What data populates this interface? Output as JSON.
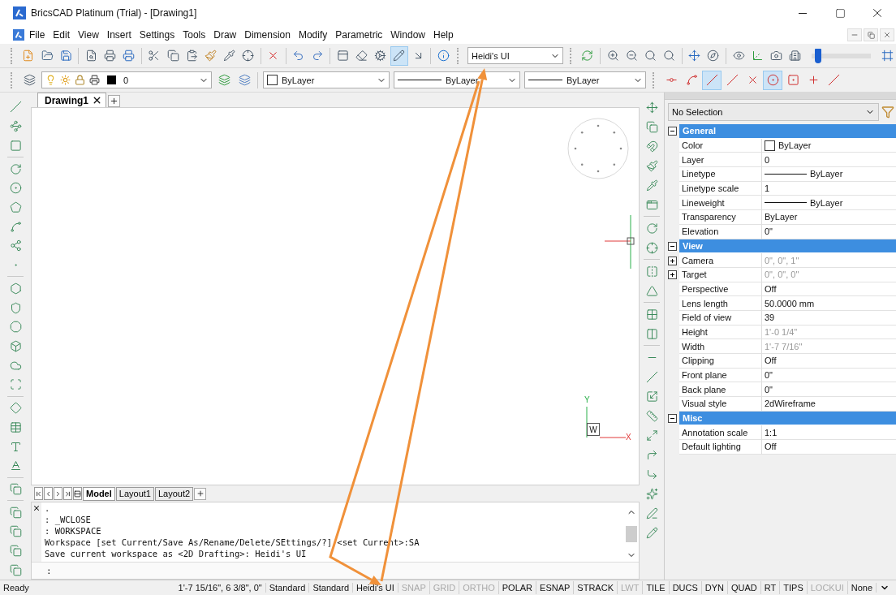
{
  "window": {
    "title": "BricsCAD Platinum (Trial) - [Drawing1]"
  },
  "menus": [
    "File",
    "Edit",
    "View",
    "Insert",
    "Settings",
    "Tools",
    "Draw",
    "Dimension",
    "Modify",
    "Parametric",
    "Window",
    "Help"
  ],
  "standard_toolbar": {
    "buttons": [
      {
        "selected": false
      },
      {
        "selected": false
      },
      {
        "selected": false
      },
      {
        "selected": false
      },
      {
        "selected": false
      },
      {
        "selected": false
      },
      {
        "selected": false
      },
      {
        "selected": false
      },
      {
        "selected": false
      },
      {
        "selected": false
      },
      {
        "selected": false
      },
      {
        "selected": false
      },
      {
        "selected": false
      },
      {
        "selected": false
      },
      {
        "selected": false
      },
      {
        "selected": false
      },
      {
        "selected": false
      },
      {
        "selected": false
      },
      {
        "selected": true
      },
      {
        "selected": false
      },
      {
        "selected": false
      }
    ],
    "workspace": "Heidi's UI",
    "slider": {
      "level": 0.06
    }
  },
  "layer_toolbar": {
    "layer": "0",
    "color_setting": "ByLayer",
    "linetype": "ByLayer",
    "lineweight": "ByLayer",
    "snap_buttons": [
      {
        "selected": false
      },
      {
        "selected": false
      },
      {
        "selected": true
      },
      {
        "selected": false
      },
      {
        "selected": false
      },
      {
        "selected": true
      },
      {
        "selected": false
      },
      {
        "selected": false
      },
      {
        "selected": false
      }
    ]
  },
  "doc_tabs": [
    {
      "label": "Drawing1",
      "selected": true
    }
  ],
  "canvas": {
    "ucs": {
      "y": "Y",
      "w": "W",
      "x": "X"
    }
  },
  "layout_tabs": [
    {
      "label": "Model",
      "selected": true
    },
    {
      "label": "Layout1",
      "selected": false
    },
    {
      "label": "Layout2",
      "selected": false
    }
  ],
  "command_line": {
    "history": [
      ".",
      ": _WCLOSE",
      ": WORKSPACE",
      "Workspace [set Current/Save As/Rename/Delete/SEttings/?] <set Current>:SA",
      "Save current workspace as <2D Drafting>: Heidi's UI"
    ],
    "prompt": ":"
  },
  "properties": {
    "selection": "No Selection",
    "groups": [
      {
        "title": "General",
        "expanded": true,
        "rows": [
          {
            "label": "Color",
            "value": "ByLayer",
            "kind": "swatch",
            "dimmed": false
          },
          {
            "label": "Layer",
            "value": "0",
            "kind": "text",
            "dimmed": false
          },
          {
            "label": "Linetype",
            "value": "ByLayer",
            "kind": "line",
            "dimmed": false
          },
          {
            "label": "Linetype scale",
            "value": "1",
            "kind": "text",
            "dimmed": false
          },
          {
            "label": "Lineweight",
            "value": "ByLayer",
            "kind": "line",
            "dimmed": false
          },
          {
            "label": "Transparency",
            "value": "ByLayer",
            "kind": "text",
            "dimmed": false
          },
          {
            "label": "Elevation",
            "value": "0\"",
            "kind": "text",
            "dimmed": false
          }
        ]
      },
      {
        "title": "View",
        "expanded": true,
        "rows": [
          {
            "label": "Camera",
            "value": "0\", 0\", 1\"",
            "kind": "text",
            "dimmed": true,
            "expanded": false
          },
          {
            "label": "Target",
            "value": "0\", 0\", 0\"",
            "kind": "text",
            "dimmed": true,
            "expanded": false
          },
          {
            "label": "Perspective",
            "value": "Off",
            "kind": "text",
            "dimmed": false
          },
          {
            "label": "Lens length",
            "value": "50.0000 mm",
            "kind": "text",
            "dimmed": false
          },
          {
            "label": "Field of view",
            "value": "39",
            "kind": "text",
            "dimmed": false
          },
          {
            "label": "Height",
            "value": "1'-0 1/4\"",
            "kind": "text",
            "dimmed": true
          },
          {
            "label": "Width",
            "value": "1'-7 7/16\"",
            "kind": "text",
            "dimmed": true
          },
          {
            "label": "Clipping",
            "value": "Off",
            "kind": "text",
            "dimmed": false
          },
          {
            "label": "Front plane",
            "value": "0\"",
            "kind": "text",
            "dimmed": false
          },
          {
            "label": "Back plane",
            "value": "0\"",
            "kind": "text",
            "dimmed": false
          },
          {
            "label": "Visual style",
            "value": "2dWireframe",
            "kind": "text",
            "dimmed": false
          }
        ]
      },
      {
        "title": "Misc",
        "expanded": true,
        "rows": [
          {
            "label": "Annotation scale",
            "value": "1:1",
            "kind": "text",
            "dimmed": false
          },
          {
            "label": "Default lighting",
            "value": "Off",
            "kind": "text",
            "dimmed": false
          }
        ]
      }
    ]
  },
  "status_bar": {
    "state": "Ready",
    "coords": "1'-7 15/16\", 6 3/8\", 0\"",
    "texts": [
      "Standard",
      "Standard",
      "Heidi's UI"
    ],
    "toggles": [
      {
        "label": "SNAP",
        "on": false
      },
      {
        "label": "GRID",
        "on": false
      },
      {
        "label": "ORTHO",
        "on": false
      },
      {
        "label": "POLAR",
        "on": true
      },
      {
        "label": "ESNAP",
        "on": true
      },
      {
        "label": "STRACK",
        "on": true
      },
      {
        "label": "LWT",
        "on": false
      },
      {
        "label": "TILE",
        "on": true
      },
      {
        "label": "DUCS",
        "on": true
      },
      {
        "label": "DYN",
        "on": true
      },
      {
        "label": "QUAD",
        "on": true
      },
      {
        "label": "RT",
        "on": true
      },
      {
        "label": "TIPS",
        "on": true
      },
      {
        "label": "LOCKUI",
        "on": false
      }
    ],
    "snap_mode": "None"
  }
}
